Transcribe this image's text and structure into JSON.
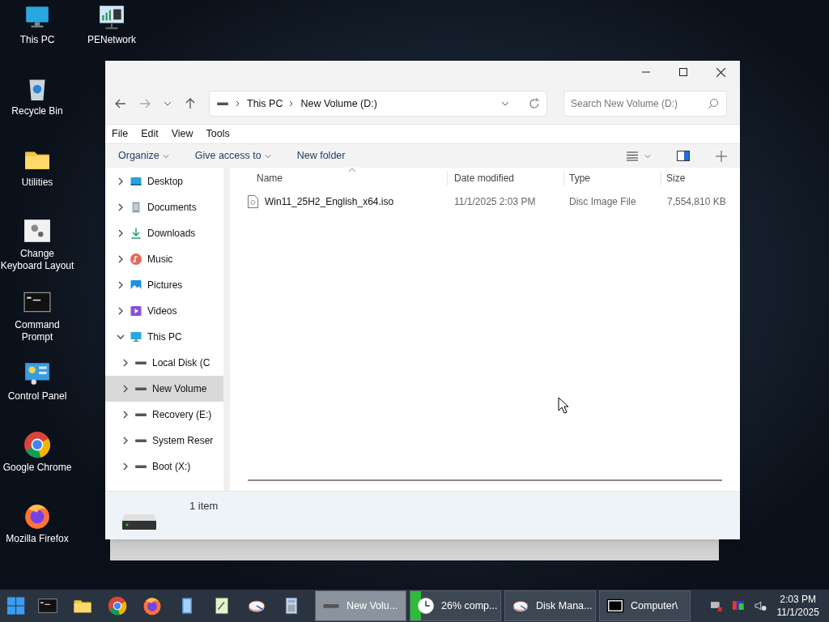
{
  "desktop_icons": [
    {
      "label": "This PC",
      "kind": "pc"
    },
    {
      "label": "Recycle Bin",
      "kind": "bin"
    },
    {
      "label": "Utilities",
      "kind": "folder"
    },
    {
      "label": "Change Keyboard Layout",
      "kind": "gears"
    },
    {
      "label": "Command Prompt",
      "kind": "cmd"
    },
    {
      "label": "Control Panel",
      "kind": "panel"
    },
    {
      "label": "Google Chrome",
      "kind": "chrome"
    },
    {
      "label": "Mozilla Firefox",
      "kind": "firefox"
    }
  ],
  "desktop_icons_col2": [
    {
      "label": "PENetwork",
      "kind": "network"
    }
  ],
  "window": {
    "address": [
      "This PC",
      "New Volume (D:)"
    ],
    "search": {
      "placeholder": "Search New Volume (D:)"
    },
    "menu": [
      "File",
      "Edit",
      "View",
      "Tools"
    ],
    "toolbar": [
      {
        "label": "Organize",
        "dropdown": true
      },
      {
        "label": "Give access to",
        "dropdown": true
      },
      {
        "label": "New folder",
        "dropdown": false
      }
    ],
    "nav": [
      {
        "label": "Desktop",
        "kind": "desktop",
        "expanded": false,
        "selected": false
      },
      {
        "label": "Documents",
        "kind": "documents",
        "expanded": false,
        "selected": false
      },
      {
        "label": "Downloads",
        "kind": "downloads",
        "expanded": false,
        "selected": false
      },
      {
        "label": "Music",
        "kind": "music",
        "expanded": false,
        "selected": false
      },
      {
        "label": "Pictures",
        "kind": "pictures",
        "expanded": false,
        "selected": false
      },
      {
        "label": "Videos",
        "kind": "videos",
        "expanded": false,
        "selected": false
      },
      {
        "label": "This PC",
        "kind": "pc",
        "expanded": true,
        "selected": false,
        "children": [
          {
            "label": "Local Disk (C",
            "kind": "drive",
            "expanded": false,
            "selected": false
          },
          {
            "label": "New Volume",
            "kind": "drive",
            "expanded": false,
            "selected": true
          },
          {
            "label": "Recovery (E:)",
            "kind": "drive",
            "expanded": false,
            "selected": false
          },
          {
            "label": "System Reser",
            "kind": "drive",
            "expanded": false,
            "selected": false
          },
          {
            "label": "Boot (X:)",
            "kind": "drive",
            "expanded": false,
            "selected": false
          }
        ]
      }
    ],
    "table": {
      "columns": [
        "Name",
        "Date modified",
        "Type",
        "Size"
      ],
      "rows": [
        {
          "name": "Win11_25H2_English_x64.iso",
          "date": "11/1/2025 2:03 PM",
          "type": "Disc Image File",
          "size": "7,554,810 KB"
        }
      ]
    },
    "status": "1 item"
  },
  "taskbar": {
    "pinned": [
      {
        "kind": "cmd"
      },
      {
        "kind": "folder"
      },
      {
        "kind": "chrome"
      },
      {
        "kind": "firefox"
      },
      {
        "kind": "notepad"
      },
      {
        "kind": "notes"
      },
      {
        "kind": "disk"
      },
      {
        "kind": "calculator"
      }
    ],
    "tasks": [
      {
        "label": "New Volu...",
        "kind": "drive",
        "selected": true
      },
      {
        "label": "26% comp...",
        "kind": "clock",
        "selected": false,
        "level": 0.12
      },
      {
        "label": "Disk Mana...",
        "kind": "disk",
        "selected": false
      },
      {
        "label": "Computer\\",
        "kind": "sevenzip",
        "selected": false
      }
    ],
    "time": "2:03 PM",
    "date": "11/1/2025"
  }
}
